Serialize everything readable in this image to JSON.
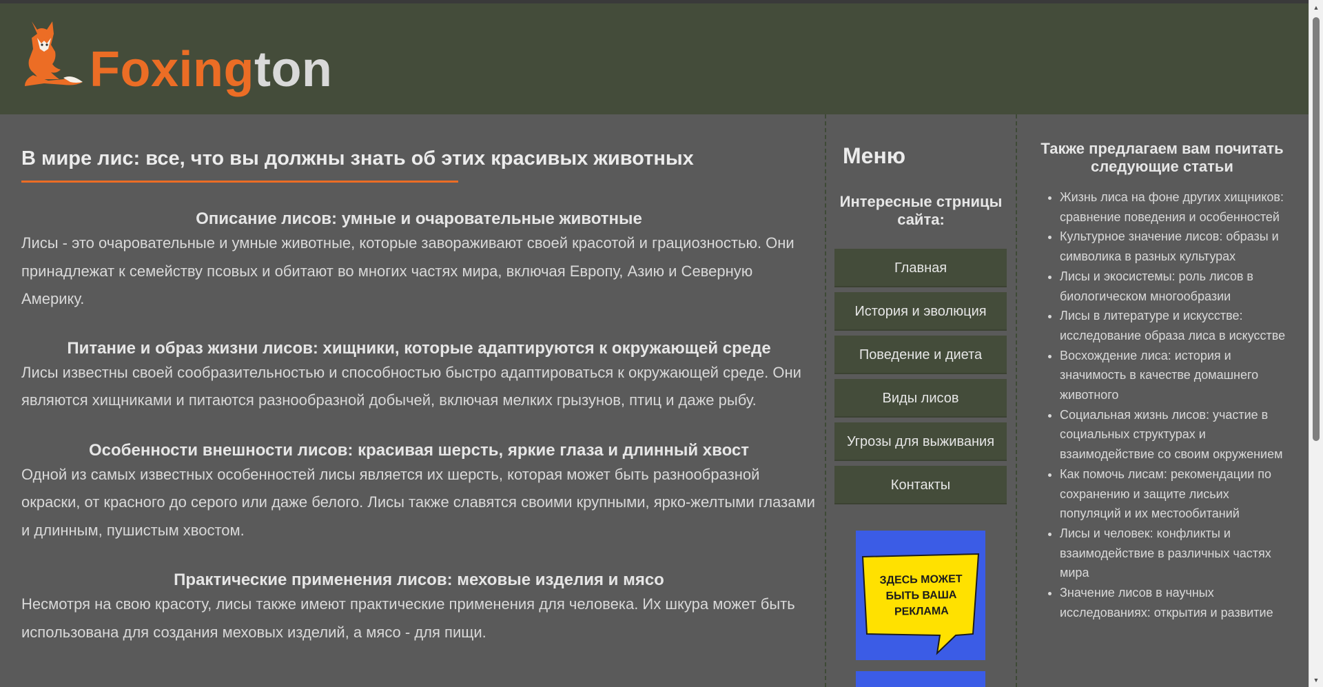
{
  "header": {
    "logo_text_a": "Foxing",
    "logo_text_b": "ton",
    "logo_icon": "fox-icon"
  },
  "main": {
    "title": "В мире лис: все, что вы должны знать об этих красивых животных",
    "sections": [
      {
        "heading": "Описание лисов: умные и очаровательные животные",
        "text": "Лисы - это очаровательные и умные животные, которые завораживают своей красотой и грациозностью. Они принадлежат к семейству псовых и обитают во многих частях мира, включая Европу, Азию и Северную Америку."
      },
      {
        "heading": "Питание и образ жизни лисов: хищники, которые адаптируются к окружающей среде",
        "text": "Лисы известны своей сообразительностью и способностью быстро адаптироваться к окружающей среде. Они являются хищниками и питаются разнообразной добычей, включая мелких грызунов, птиц и даже рыбу."
      },
      {
        "heading": "Особенности внешности лисов: красивая шерсть, яркие глаза и длинный хвост",
        "text": "Одной из самых известных особенностей лисы является их шерсть, которая может быть разнообразной окраски, от красного до серого или даже белого. Лисы также славятся своими крупными, ярко-желтыми глазами и длинным, пушистым хвостом."
      },
      {
        "heading": "Практические применения лисов: меховые изделия и мясо",
        "text": "Несмотря на свою красоту, лисы также имеют практические применения для человека. Их шкура может быть использована для создания меховых изделий, а мясо - для пищи."
      }
    ]
  },
  "menu": {
    "title": "Меню",
    "subtitle": "Интересные стрницы сайта:",
    "items": [
      {
        "label": "Главная"
      },
      {
        "label": "История и эволюция"
      },
      {
        "label": "Поведение и диета"
      },
      {
        "label": "Виды лисов"
      },
      {
        "label": "Угрозы для выживания"
      },
      {
        "label": "Контакты"
      }
    ],
    "ad_text": "ЗДЕСЬ МОЖЕТ БЫТЬ ВАША РЕКЛАМА"
  },
  "articles": {
    "title": "Также предлагаем вам почитать следующие статьи",
    "items": [
      "Жизнь лиса на фоне других хищников: сравнение поведения и особенностей",
      "Культурное значение лисов: образы и символика в разных культурах",
      "Лисы и экосистемы: роль лисов в биологическом многообразии",
      "Лисы в литературе и искусстве: исследование образа лиса в искусстве",
      "Восхождение лиса: история и значимость в качестве домашнего животного",
      "Социальная жизнь лисов: участие в социальных структурах и взаимодействие со своим окружением",
      "Как помочь лисам: рекомендации по сохранению и защите лисьих популяций и их местообитаний",
      "Лисы и человек: конфликты и взаимодействие в различных частях мира",
      "Значение лисов в научных исследованиях: открытия и развитие"
    ]
  },
  "colors": {
    "header_bg": "#444c3a",
    "page_bg": "#5a5a5a",
    "accent": "#ec6d25",
    "ad_blue": "#3b5ce6",
    "ad_yellow": "#ffe100"
  }
}
